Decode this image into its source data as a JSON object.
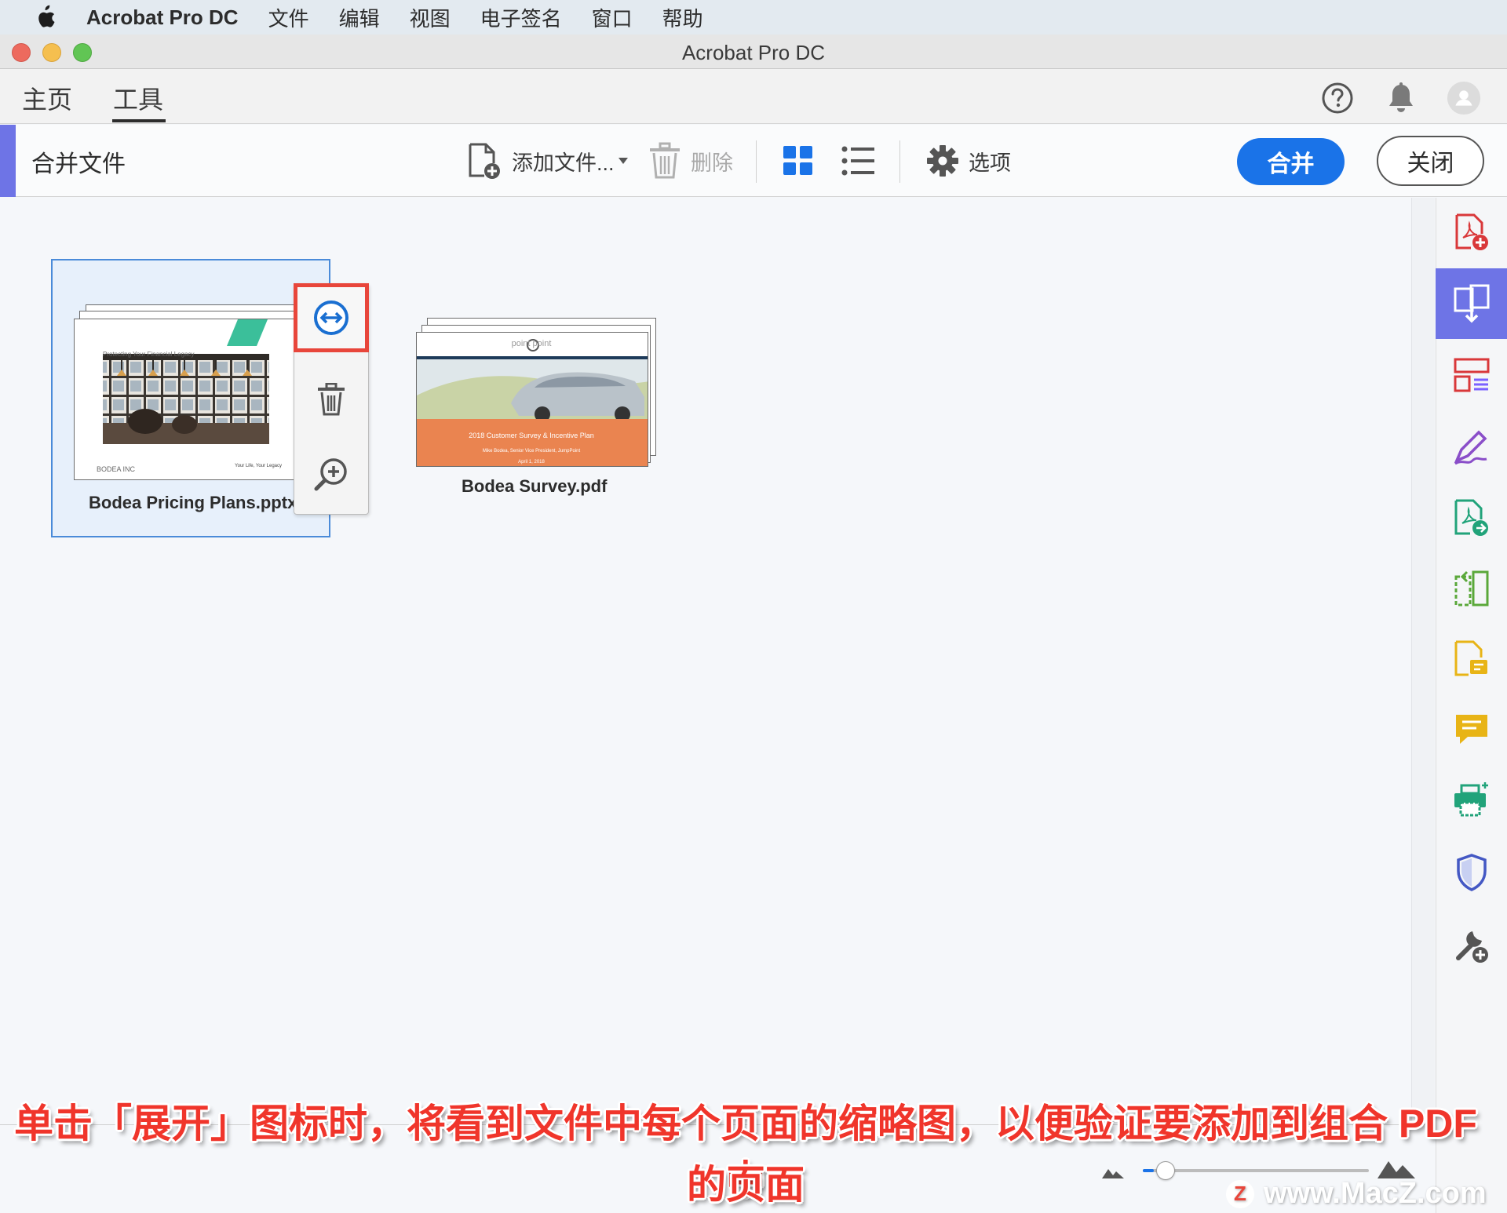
{
  "menubar": {
    "app_name": "Acrobat Pro DC",
    "items": [
      "文件",
      "编辑",
      "视图",
      "电子签名",
      "窗口",
      "帮助"
    ]
  },
  "window": {
    "title": "Acrobat Pro DC"
  },
  "nav": {
    "tabs": [
      {
        "label": "主页"
      },
      {
        "label": "工具"
      }
    ],
    "active_tab": "工具"
  },
  "toolbar": {
    "title": "合并文件",
    "add_files_label": "添加文件...",
    "delete_label": "删除",
    "options_label": "选项",
    "merge_label": "合并",
    "close_label": "关闭"
  },
  "files": [
    {
      "name": "Bodea Pricing Plans.pptx",
      "slide_title": "Protecting Your Financial Legacy",
      "slide_foot_left": "BODEA INC",
      "slide_foot_right": "Your Life, Your Legacy",
      "selected": true
    },
    {
      "name": "Bodea Survey.pdf",
      "brand": "point  point",
      "slide_title": "2018 Customer Survey & Incentive Plan",
      "slide_sub": "Mike Bodea, Senior Vice President, JumpPoint",
      "slide_date": "April 1, 2018"
    }
  ],
  "file_actions": [
    "expand-icon",
    "trash-icon",
    "zoom-in-icon"
  ],
  "sidebar_tools": [
    "create-pdf-icon",
    "combine-files-icon",
    "organize-pages-icon",
    "fill-sign-icon",
    "export-pdf-icon",
    "compress-icon",
    "edit-pdf-icon",
    "comment-icon",
    "print-production-icon",
    "protect-icon",
    "more-tools-icon"
  ],
  "zoom": {
    "level": 0.05
  },
  "colors": {
    "accent": "#6e74e6",
    "primary": "#1a73e8",
    "highlight": "#e8463b"
  },
  "caption": {
    "line1": "单击「展开」图标时，将看到文件中每个页面的缩略图，以便验证要添加到组合 PDF 中",
    "line2": "的页面"
  },
  "watermark": "www.MacZ.com"
}
